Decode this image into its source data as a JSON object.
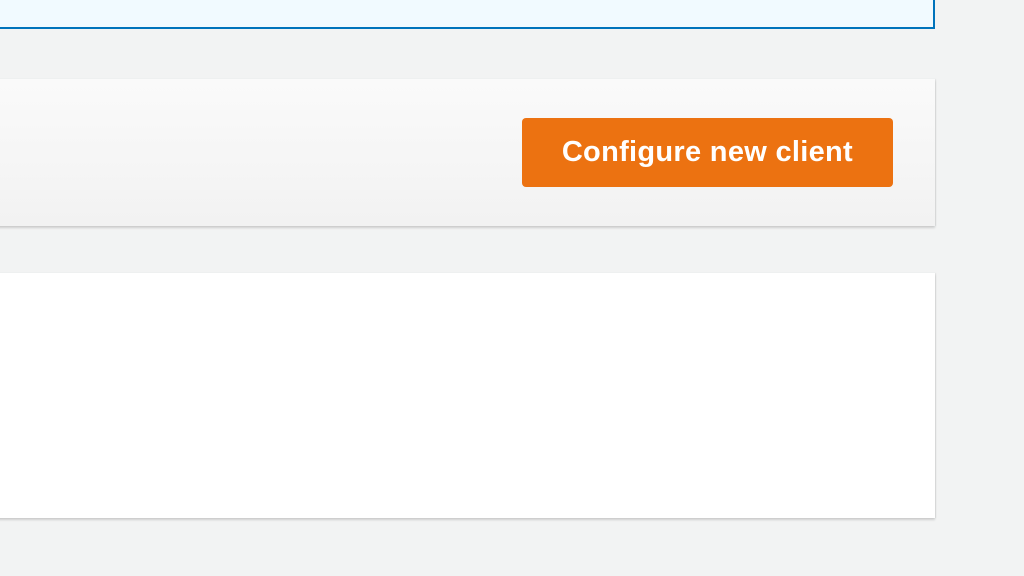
{
  "actionBar": {
    "primaryButton": "Configure new client"
  }
}
